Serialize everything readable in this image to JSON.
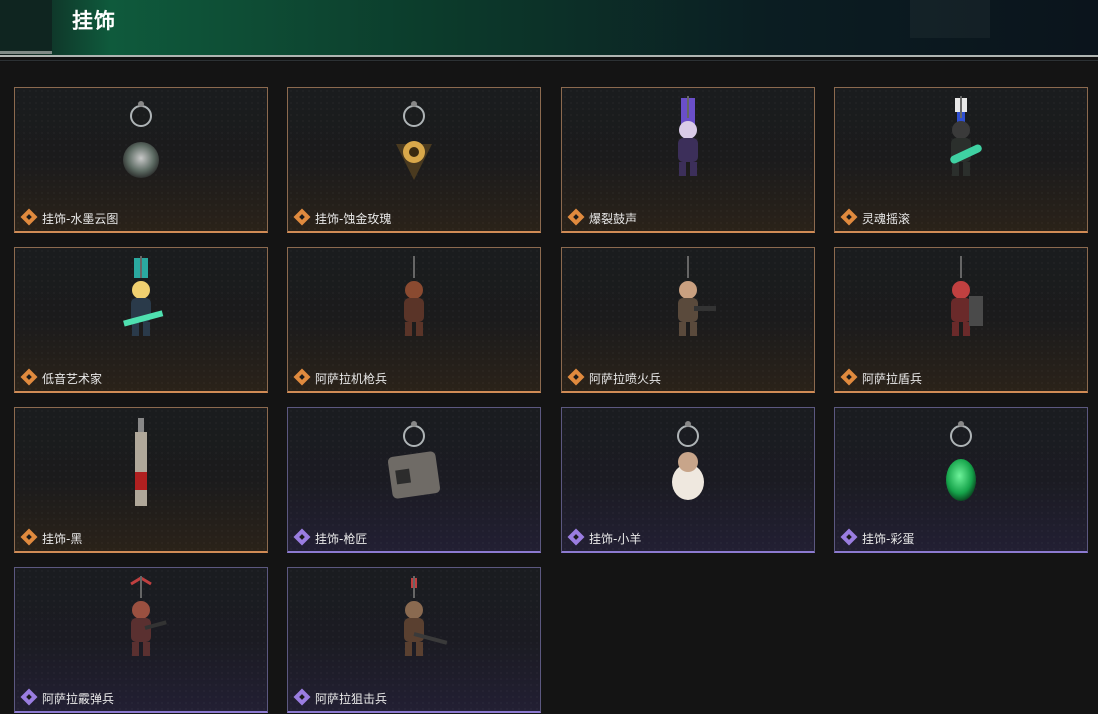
{
  "header": {
    "title": "挂饰"
  },
  "items": [
    {
      "name": "挂饰-水墨云图",
      "rarity": "orange",
      "icon": "orb-charm-icon"
    },
    {
      "name": "挂饰-蚀金玫瑰",
      "rarity": "orange",
      "icon": "rose-charm-icon"
    },
    {
      "name": "爆裂鼓声",
      "rarity": "orange",
      "icon": "drummer-figure-icon"
    },
    {
      "name": "灵魂摇滚",
      "rarity": "orange",
      "icon": "guitarist-figure-icon"
    },
    {
      "name": "低音艺术家",
      "rarity": "orange",
      "icon": "bassist-figure-icon"
    },
    {
      "name": "阿萨拉机枪兵",
      "rarity": "orange",
      "icon": "machine-gunner-figure-icon"
    },
    {
      "name": "阿萨拉喷火兵",
      "rarity": "orange",
      "icon": "flamethrower-figure-icon"
    },
    {
      "name": "阿萨拉盾兵",
      "rarity": "orange",
      "icon": "shield-soldier-figure-icon"
    },
    {
      "name": "挂饰-黑",
      "rarity": "orange",
      "icon": "blade-charm-icon"
    },
    {
      "name": "挂饰-枪匠",
      "rarity": "purple",
      "icon": "gunsmith-case-icon"
    },
    {
      "name": "挂饰-小羊",
      "rarity": "purple",
      "icon": "lamb-figure-icon"
    },
    {
      "name": "挂饰-彩蛋",
      "rarity": "purple",
      "icon": "easter-egg-icon"
    },
    {
      "name": "阿萨拉霰弹兵",
      "rarity": "purple",
      "icon": "shotgunner-figure-icon"
    },
    {
      "name": "阿萨拉狙击兵",
      "rarity": "purple",
      "icon": "sniper-figure-icon"
    }
  ],
  "colors": {
    "orange_rarity": "#e08a3e",
    "purple_rarity": "#9a7de0",
    "header_green": "#0f5a3c"
  }
}
